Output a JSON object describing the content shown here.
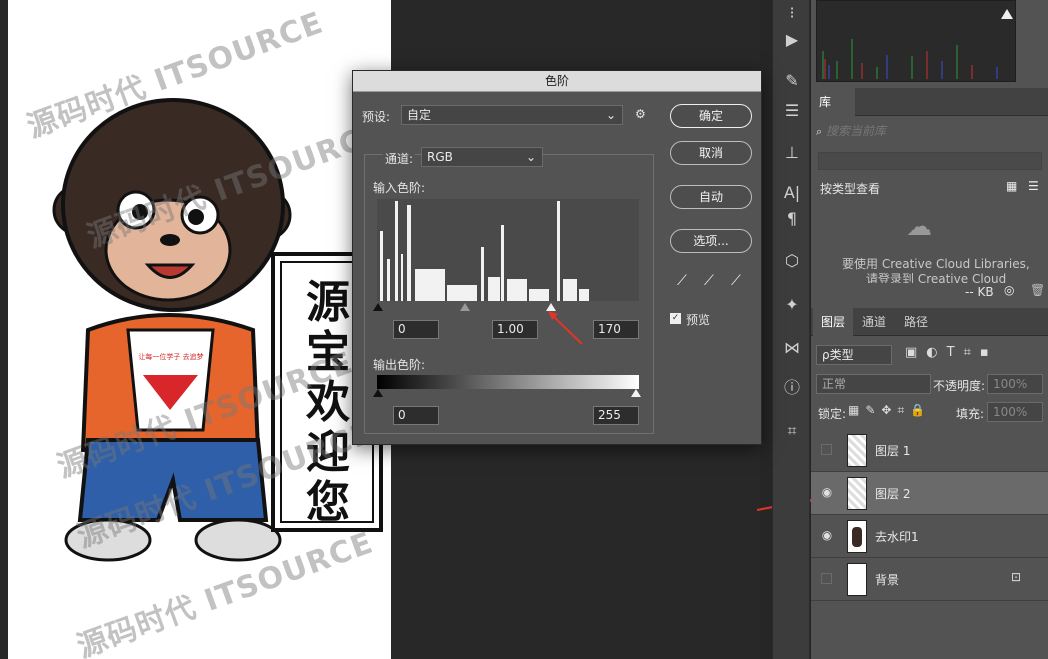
{
  "dialog": {
    "title": "色阶",
    "preset_label": "预设:",
    "preset_value": "自定",
    "channel_label": "通道:",
    "channel_value": "RGB",
    "input_levels_label": "输入色阶:",
    "output_levels_label": "输出色阶:",
    "input_black": "0",
    "input_gamma": "1.00",
    "input_white": "170",
    "output_black": "0",
    "output_white": "255",
    "buttons": {
      "ok": "确定",
      "cancel": "取消",
      "auto": "自动",
      "options": "选项..."
    },
    "preview_label": "预览",
    "preview_checked": true
  },
  "canvas": {
    "sign_text": [
      "源",
      "宝",
      "欢",
      "迎",
      "您"
    ],
    "watermark": [
      "源码时代 ITSOURCE",
      "源码时代 ITSOURCE",
      "源码时代 ITSOURCE",
      "源码时代 ITSOURCE",
      "源码时代 ITSOURCE"
    ],
    "shirt_text": "让每一位学子 去追梦"
  },
  "library": {
    "tab": "库",
    "search_placeholder": "搜索当前库",
    "view_by": "按类型查看",
    "cc_message_1": "要使用 Creative Cloud Libraries,",
    "cc_message_2": "请登录到 Creative Cloud",
    "size": "-- KB"
  },
  "layers_panel": {
    "tabs": [
      "图层",
      "通道",
      "路径"
    ],
    "filter_label": "ρ类型",
    "blend_mode": "正常",
    "opacity_label": "不透明度:",
    "opacity_value": "100%",
    "lock_label": "锁定:",
    "fill_label": "填充:",
    "fill_value": "100%",
    "layers": [
      {
        "name": "图层 1",
        "visible": false,
        "selected": false
      },
      {
        "name": "图层 2",
        "visible": true,
        "selected": true
      },
      {
        "name": "去水印1",
        "visible": true,
        "selected": false
      },
      {
        "name": "背景",
        "visible": false,
        "selected": false,
        "locked": true
      }
    ]
  },
  "colors": {
    "accent_red": "#e2352a",
    "panel": "#535353",
    "dark": "#262626"
  }
}
